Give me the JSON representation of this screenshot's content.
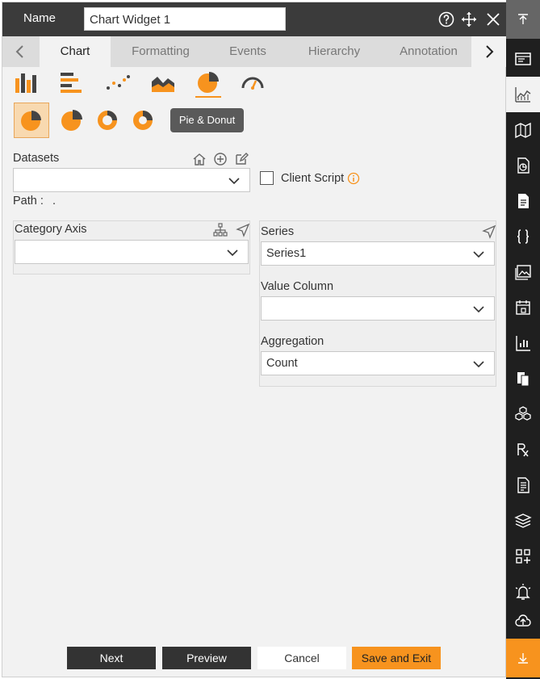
{
  "header": {
    "name_label": "Name",
    "widget_name": "Chart Widget 1",
    "icons": [
      "help-icon",
      "move-icon",
      "close-icon"
    ]
  },
  "tabs": [
    {
      "label": "Chart",
      "active": true
    },
    {
      "label": "Formatting",
      "active": false
    },
    {
      "label": "Events",
      "active": false
    },
    {
      "label": "Hierarchy",
      "active": false
    },
    {
      "label": "Annotation",
      "active": false
    }
  ],
  "chart_types": [
    "column-chart-icon",
    "bar-chart-icon",
    "scatter-chart-icon",
    "area-chart-icon",
    "pie-chart-icon",
    "gauge-chart-icon"
  ],
  "selected_chart_type": "pie-chart-icon",
  "pie_variants": [
    "pie",
    "pie-exploded",
    "donut",
    "donut-thick"
  ],
  "tooltip": "Pie & Donut",
  "datasets": {
    "label": "Datasets",
    "value": "",
    "path_label": "Path :",
    "path_value": "."
  },
  "client_script": {
    "label": "Client Script",
    "checked": false
  },
  "category_axis": {
    "label": "Category Axis",
    "value": ""
  },
  "series": {
    "label": "Series",
    "value": "Series1",
    "value_column_label": "Value Column",
    "value_column_value": "",
    "aggregation_label": "Aggregation",
    "aggregation_value": "Count"
  },
  "footer": {
    "next": "Next",
    "preview": "Preview",
    "cancel": "Cancel",
    "save_exit": "Save and Exit"
  },
  "colors": {
    "accent": "#f7931e",
    "header_bg": "#3b3b3b",
    "rail_bg": "#1f1f1f"
  }
}
